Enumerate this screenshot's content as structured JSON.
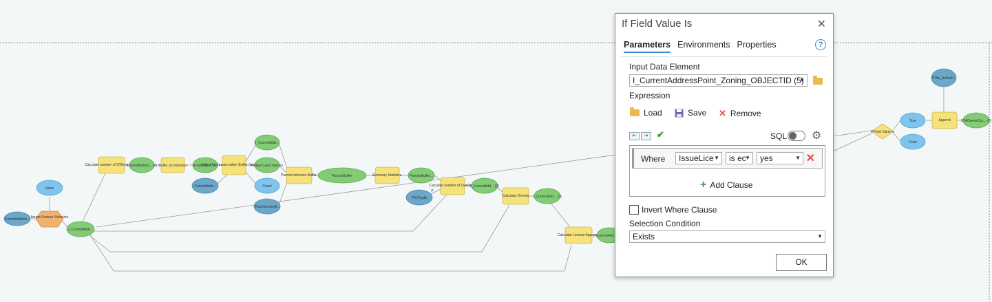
{
  "dialog": {
    "title": "If Field Value Is",
    "close": "✕",
    "tabs": [
      "Parameters",
      "Environments",
      "Properties"
    ],
    "help": "?",
    "input_label": "Input Data Element",
    "input_value": "I_CurrentAddressPoint_Zoning_OBJECTID (5)",
    "expression_label": "Expression",
    "load": "Load",
    "save": "Save",
    "remove": "Remove",
    "sql": "SQL",
    "clause": {
      "where": "Where",
      "field": "IssueLice",
      "operator": "is ec",
      "value": "yes"
    },
    "add_clause": "Add Clause",
    "invert": "Invert Where Clause",
    "selection_label": "Selection Condition",
    "selection_value": "Exists",
    "ok": "OK"
  },
  "nodes": {
    "n1": "CurrentAddres...",
    "n2": "Iterate Feature Selection",
    "n3": "Value",
    "n4": "I_CurrentAddr...",
    "n5": "Calculate number of STAs in Buffer",
    "n6": "CurrentAddres... (6)",
    "n7": "Buffer (in memory)",
    "n8": "tempOutput_b...",
    "n9": "Select Addresses within Buffer (in memory)",
    "n10": "CurrentAddr...",
    "n11": "I_CurrentAdd...",
    "n12": "Output Layer Names",
    "n13": "Count",
    "n14": "Parcels Intersect Buffer",
    "n15": "ParcelsBuffer",
    "n16": "Summary Statistics",
    "n17": "ParcelsBuffer...",
    "n18": "ParcelsUrbnoll...",
    "n19": "Calculate number of Dwellings",
    "n20": "TEST.gdb",
    "n21": "I_CurrentAdd... (2)",
    "n22": "Calculate Density",
    "n23": "I_CurrentAdd... (3)",
    "n24": "Calculate License Approval",
    "n25": "I_CurrentAdd... (5)",
    "n26": "If Field Value Is",
    "n27": "True",
    "n28": "False",
    "n29": "Append",
    "n30": "STAs_ActiveP...",
    "n31": "STAOwnerOcc... (2)",
    "p_label": "P"
  },
  "colors": {
    "blue_node": "#7ec4ec",
    "dark_blue_node": "#6aa7c9",
    "green_node": "#83cc76",
    "yellow_node": "#f6e27a",
    "orange_node": "#f0b26e",
    "accent": "#3a8ad1"
  }
}
